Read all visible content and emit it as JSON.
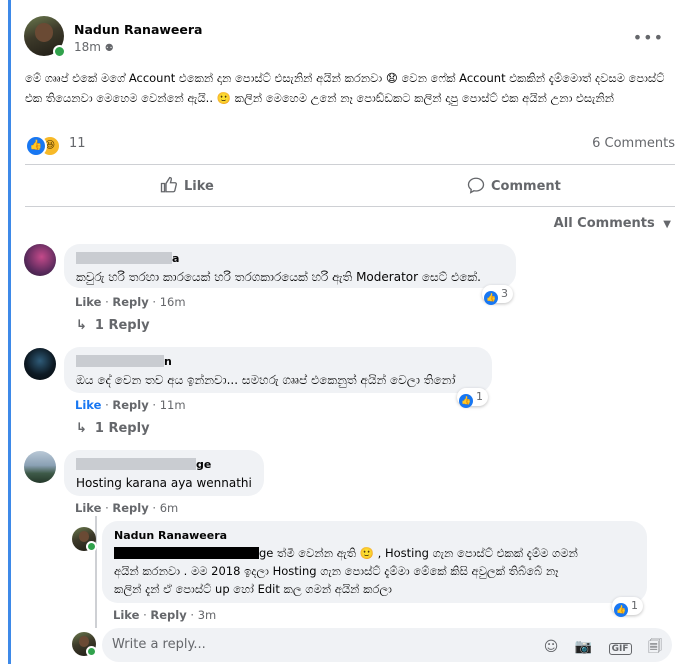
{
  "post": {
    "author": "Nadun Ranaweera",
    "time": "18m",
    "privacy_icon": "friends-icon",
    "more_icon": "•••",
    "text": "මේ ගෲප් එකේ මගේ Account එකෙන් දාන පොස්ට් එසැනින් අයින් කරනවා 😧 වෙන ෆේක් Account එකකින් දැම්මොත් දවසම පොස්ට් එක තියෙනවා මෙහෙම වෙන්නේ ඇයි.. 🙂 කලින් මෙහෙම උනේ නෑ පොඞ්ඩකට කලින් දාපු පොස්ට් එක අයින් උනා එසැනින්",
    "reactions_count": "11",
    "comments_count": "6 Comments"
  },
  "actions": {
    "like": "Like",
    "comment": "Comment"
  },
  "all_comments": "All Comments",
  "comments": [
    {
      "name_suffix": "a",
      "text": "කවුරු හරි තරහා කාරයෙක් හරි තරගකාරයෙක් හරි ඇති Moderator සෙට් එකේ.",
      "like": "Like",
      "reply": "Reply",
      "time": "16m",
      "badge": "3",
      "replies": "1 Reply"
    },
    {
      "name_suffix": "n",
      "text": "ඔය දේ වෙන තව අය ඉන්නවා... සමහරු ගෲප් එකෙනුත් අයින් වෙලා තිනෝ",
      "like": "Like",
      "reply": "Reply",
      "time": "11m",
      "badge": "1",
      "replies": "1 Reply"
    },
    {
      "name_suffix": "ge",
      "text": "Hosting karana aya wennathi",
      "like": "Like",
      "reply": "Reply",
      "time": "6m"
    }
  ],
  "reply": {
    "author": "Nadun Ranaweera",
    "line1_mid": "ge ",
    "line1_tail": "ත්මී වෙන්න ඇති 🙂 , Hosting ගැන පොස්ට් එකක් දැම්ම ගමන්",
    "line2": "අයින් කරනවා . මම 2018 ඉදලා Hosting ගැන පොස්ට් දැම්මා මේකේ කිසි අවුලක් තිබ්බේ නෑ",
    "line3": "කලින් දැන් ඒ පොස්ට් up හෝ Edit කල ගමන් අයින් කරලා",
    "like": "Like",
    "reply_label": "Reply",
    "time": "3m",
    "badge": "1"
  },
  "input": {
    "placeholder": "Write a reply..."
  },
  "colors": {
    "accent": "#1877f2",
    "online": "#31a24c",
    "bubble": "#f0f2f5"
  }
}
